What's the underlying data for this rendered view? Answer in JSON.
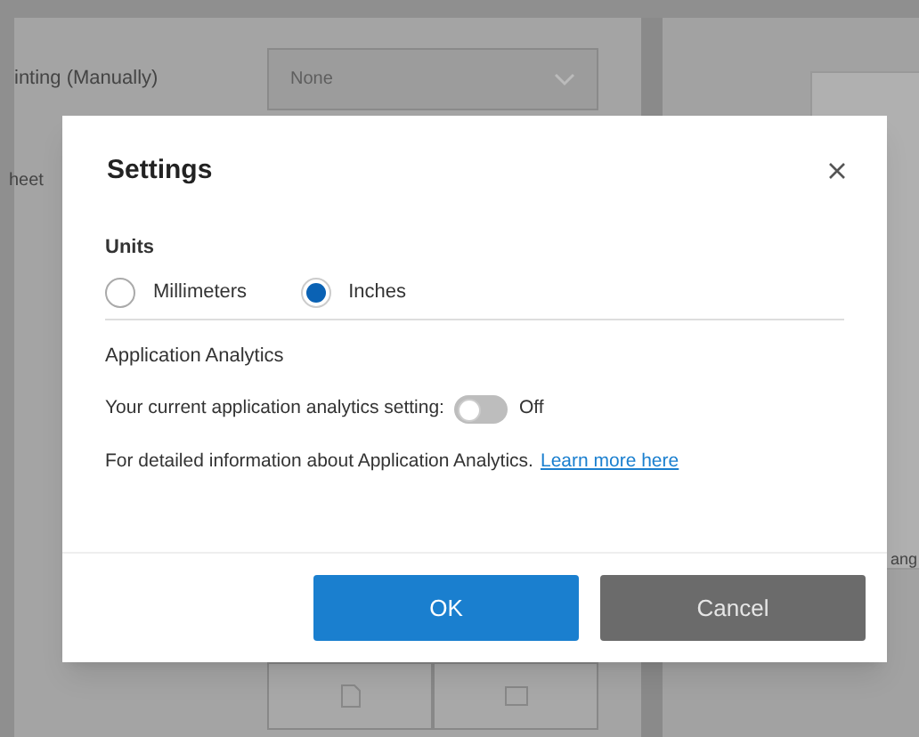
{
  "background": {
    "row_label": "inting (Manually)",
    "dropdown": {
      "value": "None"
    },
    "row_label_2": "heet",
    "side_label": "ang"
  },
  "dialog": {
    "title": "Settings",
    "units": {
      "label": "Units",
      "options": [
        {
          "label": "Millimeters",
          "selected": false
        },
        {
          "label": "Inches",
          "selected": true
        }
      ]
    },
    "analytics": {
      "heading": "Application Analytics",
      "setting_label": "Your current application analytics setting:",
      "toggle": {
        "on": false,
        "state_text": "Off"
      },
      "info_text": "For detailed information about Application Analytics.",
      "link": "Learn more here"
    },
    "buttons": [
      {
        "label": "OK",
        "kind": "primary"
      },
      {
        "label": "Cancel",
        "kind": "secondary"
      }
    ]
  }
}
